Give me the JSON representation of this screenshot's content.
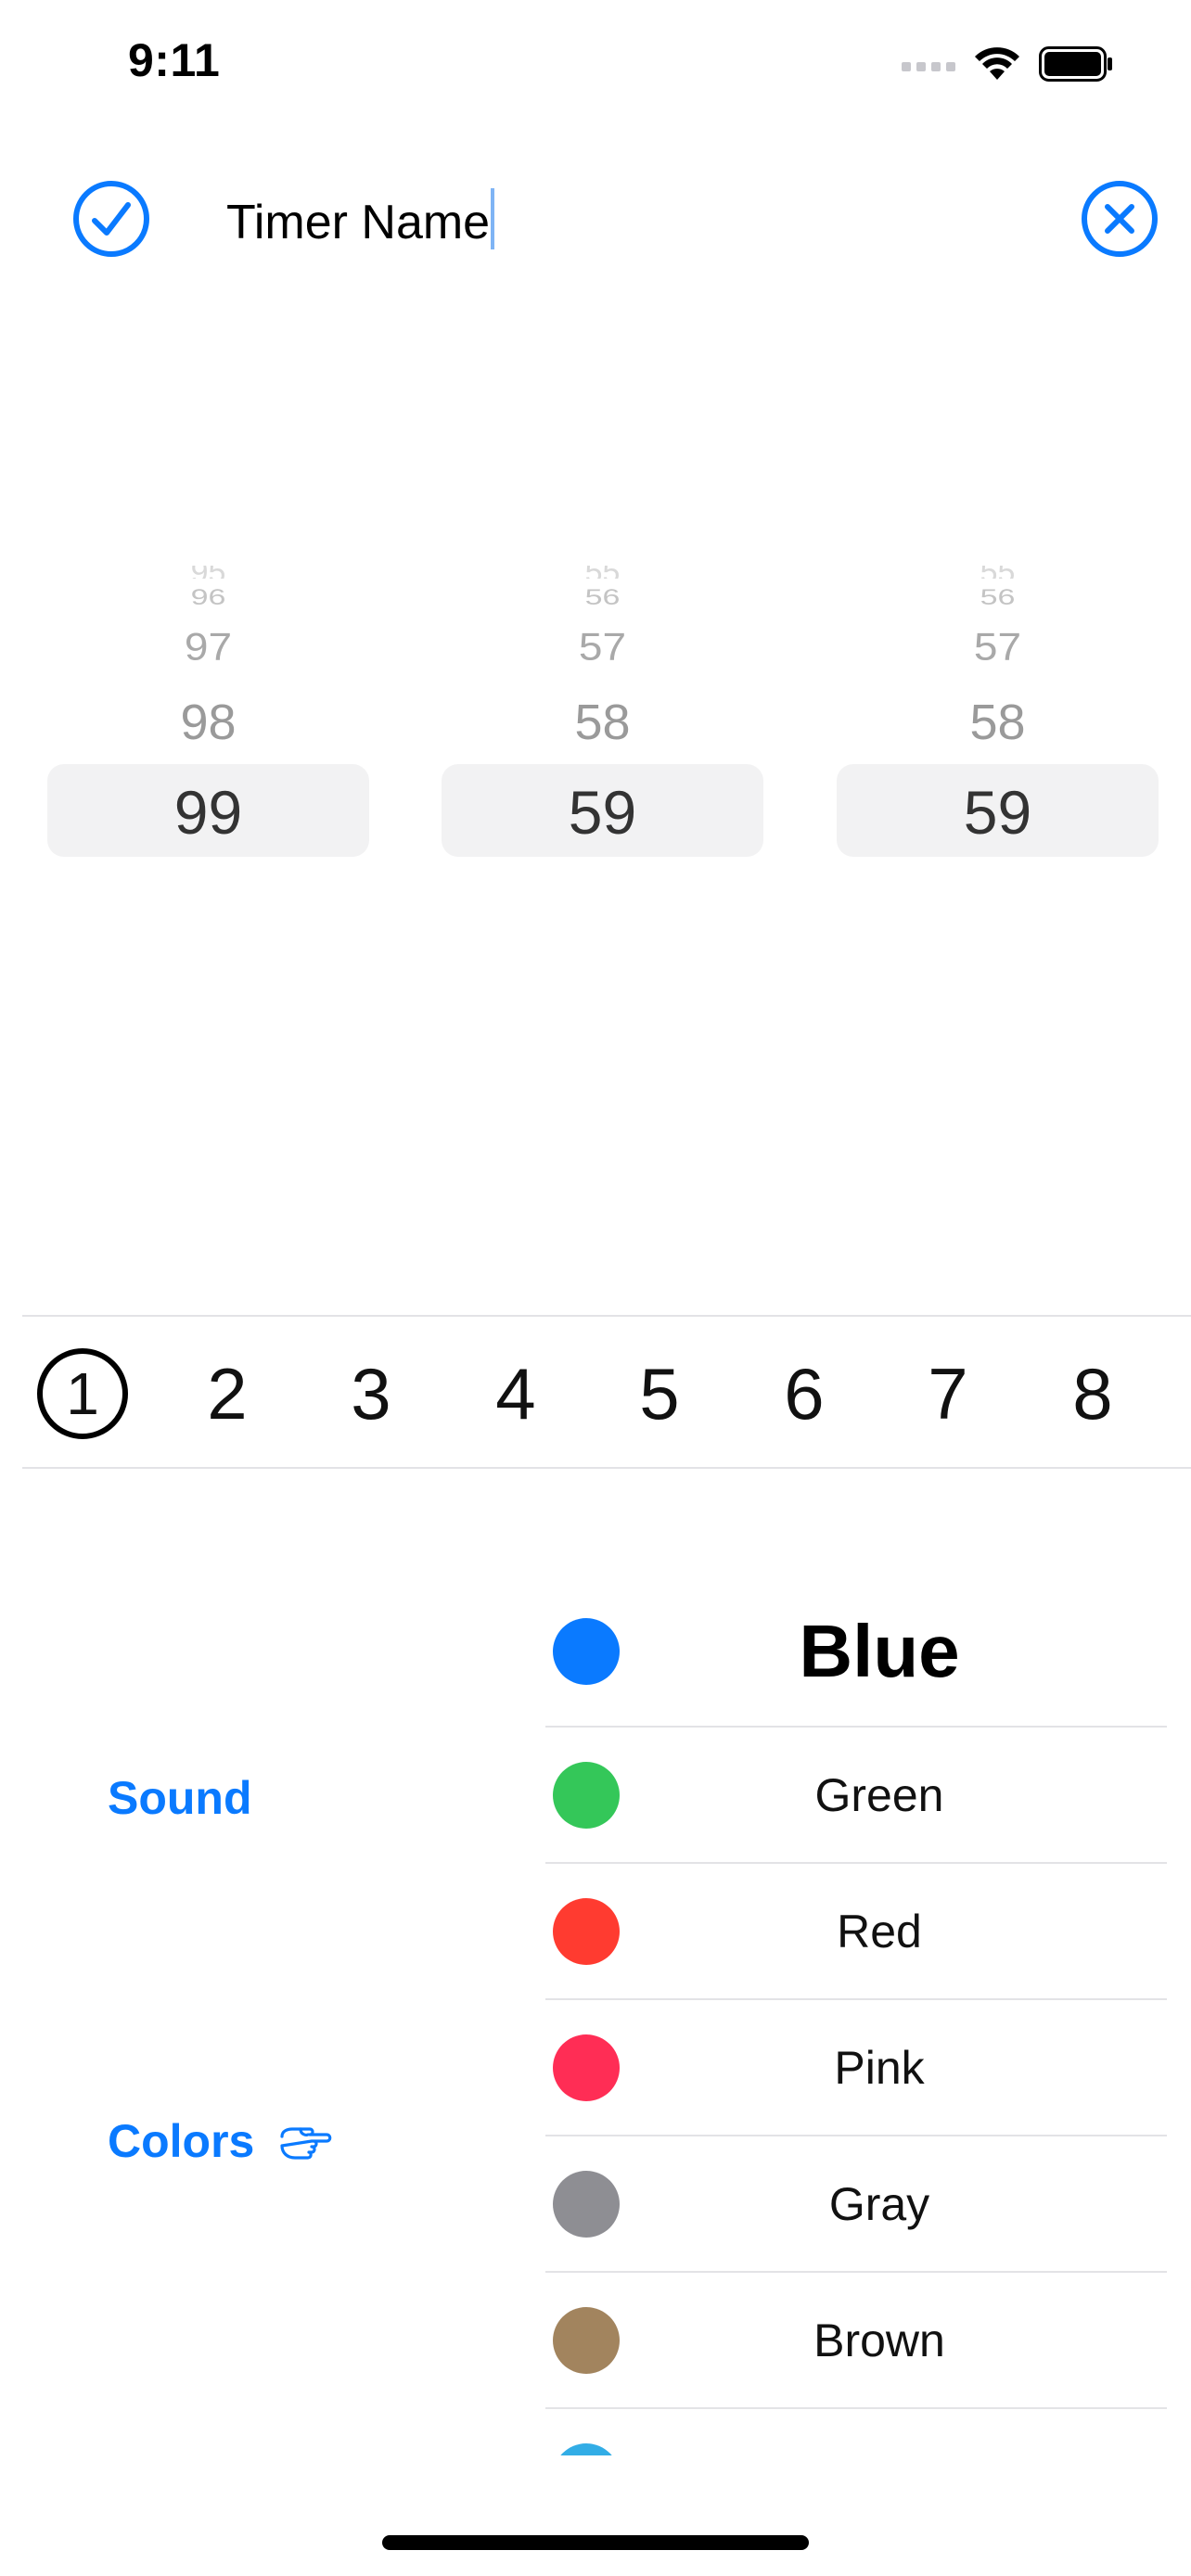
{
  "status_bar": {
    "time": "9:11"
  },
  "header": {
    "confirm_icon": "checkmark-circle-icon",
    "cancel_icon": "xmark-circle-icon",
    "timer_name": "Timer Name",
    "accent_color": "#0A7AFF"
  },
  "pickers": [
    {
      "name": "hours",
      "faint": "95",
      "above3": "96",
      "above2": "97",
      "above1": "98",
      "selected": "99"
    },
    {
      "name": "minutes",
      "faint": "55",
      "above3": "56",
      "above2": "57",
      "above1": "58",
      "selected": "59"
    },
    {
      "name": "seconds",
      "faint": "55",
      "above3": "56",
      "above2": "57",
      "above1": "58",
      "selected": "59"
    }
  ],
  "slots": {
    "items": [
      "1",
      "2",
      "3",
      "4",
      "5",
      "6",
      "7",
      "8"
    ],
    "selected": "1"
  },
  "side_menu": {
    "sound": "Sound",
    "colors": "Colors",
    "colors_pointer_icon": "hand-point-right-icon"
  },
  "colors": [
    {
      "name": "Blue",
      "hex": "#0A7AFF",
      "selected": true
    },
    {
      "name": "Green",
      "hex": "#34C759"
    },
    {
      "name": "Red",
      "hex": "#FF3B30"
    },
    {
      "name": "Pink",
      "hex": "#FF2D55"
    },
    {
      "name": "Gray",
      "hex": "#8E8E93"
    },
    {
      "name": "Brown",
      "hex": "#A2845E"
    },
    {
      "name": "",
      "hex": "#32ADE6"
    }
  ]
}
